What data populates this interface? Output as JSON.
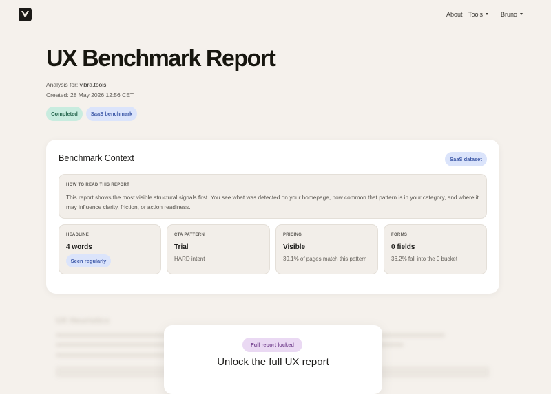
{
  "nav": {
    "logo_letter": "V",
    "about": "About",
    "tools": "Tools",
    "user": "Bruno"
  },
  "report": {
    "title": "UX Benchmark Report",
    "analysis_label": "Analysis for:",
    "analysis_site": "vibra.tools",
    "created": "Created: 28 May 2026 12:56 CET",
    "badges": [
      "Completed",
      "SaaS benchmark"
    ]
  },
  "context": {
    "title": "Benchmark Context",
    "badge": "SaaS dataset",
    "howto_heading": "HOW TO READ THIS REPORT",
    "howto_text": "This report shows the most visible structural signals first. You see what was detected on your homepage, how common that pattern is in your category, and where it may influence clarity, friction, or action readiness.",
    "metrics": [
      {
        "label": "HEADLINE",
        "value": "4 words",
        "note": "",
        "badge": "Seen regularly"
      },
      {
        "label": "CTA PATTERN",
        "value": "Trial",
        "note": "HARD intent",
        "badge": ""
      },
      {
        "label": "PRICING",
        "value": "Visible",
        "note": "39.1% of pages match this pattern",
        "badge": ""
      },
      {
        "label": "FORMS",
        "value": "0 fields",
        "note": "36.2% fall into the 0 bucket",
        "badge": ""
      }
    ]
  },
  "blurred_section": {
    "title": "UX Heuristics"
  },
  "locked": {
    "badge": "Full report locked",
    "title": "Unlock the full UX report"
  },
  "colors": {
    "background": "#f5f1ec",
    "completed_badge": "#c8ecdf",
    "saas_badge": "#dbe4fb",
    "locked_badge": "#ead9f3"
  }
}
